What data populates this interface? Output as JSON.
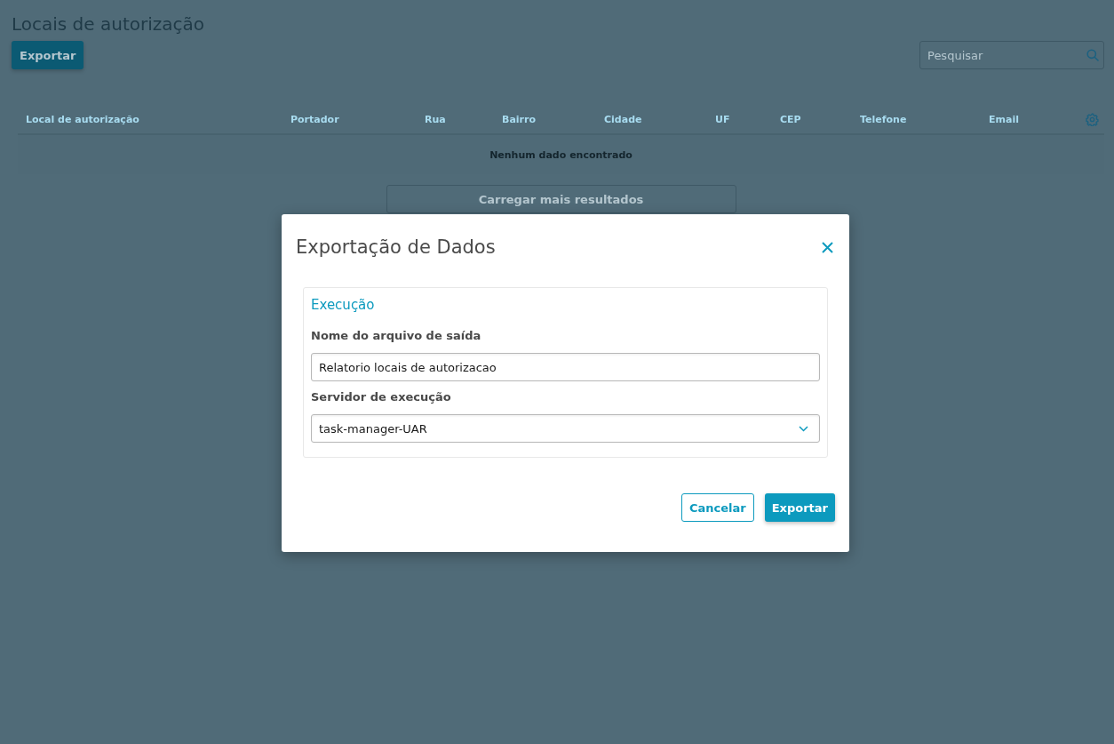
{
  "page": {
    "title": "Locais de autorização",
    "export_button": "Exportar",
    "search": {
      "placeholder": "Pesquisar"
    }
  },
  "table": {
    "columns": [
      "Local de autorização",
      "Portador",
      "Rua",
      "Bairro",
      "Cidade",
      "UF",
      "CEP",
      "Telefone",
      "Email"
    ],
    "empty_message": "Nenhum dado encontrado",
    "load_more": "Carregar mais resultados"
  },
  "dialog": {
    "title": "Exportação de Dados",
    "section": "Execução",
    "fields": [
      {
        "kind": "text",
        "label": "Nome do arquivo de saída",
        "value": "Relatorio locais de autorizacao"
      },
      {
        "kind": "select",
        "label": "Servidor de execução",
        "value": "task-manager-UAR"
      }
    ],
    "buttons": [
      {
        "kind": "secondary",
        "label": "Cancelar"
      },
      {
        "kind": "primary",
        "label": "Exportar"
      }
    ]
  }
}
